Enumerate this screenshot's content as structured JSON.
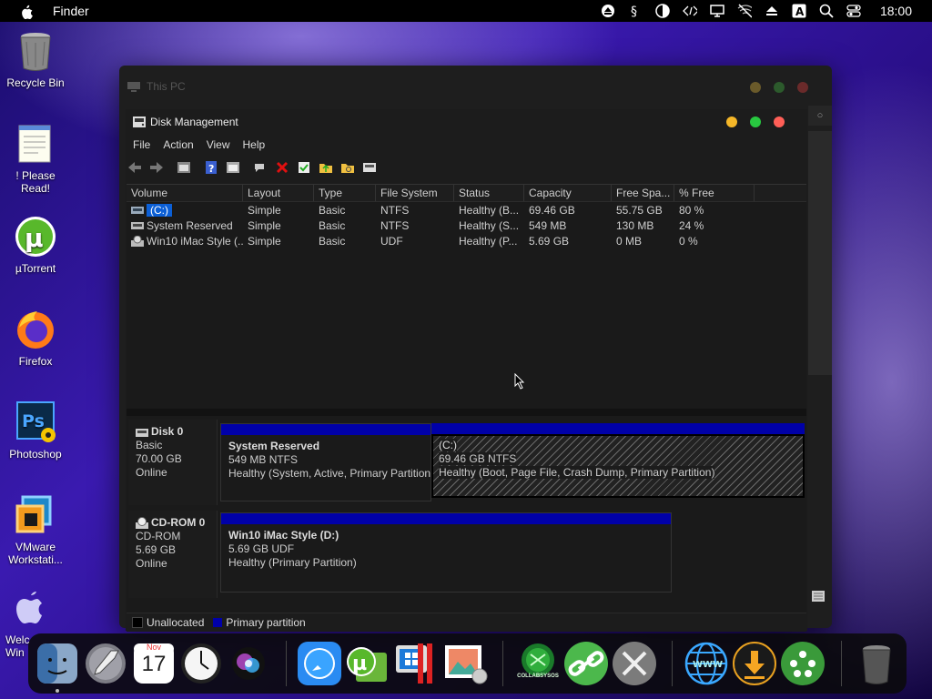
{
  "menubar": {
    "app_name": "Finder",
    "clock": "18:00",
    "status_icons": [
      "eject-icon",
      "script-icon",
      "contrast-icon",
      "code-icon",
      "display-icon",
      "wifi-off-icon",
      "eject-small-icon",
      "input-a-icon",
      "search-icon",
      "control-center-icon"
    ]
  },
  "desktop": [
    {
      "label": "Recycle Bin",
      "icon": "recycle-bin-icon"
    },
    {
      "label": "! Please Read!",
      "icon": "notepad-icon"
    },
    {
      "label": "µTorrent",
      "icon": "utorrent-icon"
    },
    {
      "label": "Firefox",
      "icon": "firefox-icon"
    },
    {
      "label": "Photoshop",
      "icon": "photoshop-icon"
    },
    {
      "label": "VMware Workstati...",
      "icon": "vmware-icon"
    },
    {
      "label": "Welc Win",
      "icon": "welcome-icon"
    }
  ],
  "back_window": {
    "title": "This PC"
  },
  "disk_mgmt": {
    "title": "Disk Management",
    "menu": [
      "File",
      "Action",
      "View",
      "Help"
    ],
    "toolbar": [
      "back-icon",
      "forward-icon",
      "properties-icon",
      "help-icon",
      "console-icon",
      "connect-icon",
      "delete-icon",
      "check-icon",
      "folder-up-icon",
      "folder-search-icon",
      "disk-icon"
    ],
    "columns": [
      "Volume",
      "Layout",
      "Type",
      "File System",
      "Status",
      "Capacity",
      "Free Spa...",
      "% Free"
    ],
    "rows": [
      {
        "volume": "(C:)",
        "layout": "Simple",
        "type": "Basic",
        "fs": "NTFS",
        "status": "Healthy (B...",
        "capacity": "69.46 GB",
        "free": "55.75 GB",
        "pct": "80 %"
      },
      {
        "volume": "System Reserved",
        "layout": "Simple",
        "type": "Basic",
        "fs": "NTFS",
        "status": "Healthy (S...",
        "capacity": "549 MB",
        "free": "130 MB",
        "pct": "24 %"
      },
      {
        "volume": "Win10 iMac Style (...",
        "layout": "Simple",
        "type": "Basic",
        "fs": "UDF",
        "status": "Healthy (P...",
        "capacity": "5.69 GB",
        "free": "0 MB",
        "pct": "0 %"
      }
    ],
    "disks": [
      {
        "name": "Disk 0",
        "kind": "Basic",
        "size": "70.00 GB",
        "state": "Online",
        "partitions": [
          {
            "title": "System Reserved",
            "size": "549 MB NTFS",
            "status": "Healthy (System, Active, Primary Partition)"
          },
          {
            "title": "(C:)",
            "size": "69.46 GB NTFS",
            "status": "Healthy (Boot, Page File, Crash Dump, Primary Partition)"
          }
        ]
      },
      {
        "name": "CD-ROM 0",
        "kind": "CD-ROM",
        "size": "5.69 GB",
        "state": "Online",
        "partitions": [
          {
            "title": "Win10 iMac Style  (D:)",
            "size": "5.69 GB UDF",
            "status": "Healthy (Primary Partition)"
          }
        ]
      }
    ],
    "legend": [
      {
        "label": "Unallocated",
        "color": "#000000"
      },
      {
        "label": "Primary partition",
        "color": "#0000a8"
      }
    ]
  },
  "dock": {
    "cal_month": "Nov",
    "cal_day": "17",
    "collab_label": "COLLABSYSOS"
  }
}
